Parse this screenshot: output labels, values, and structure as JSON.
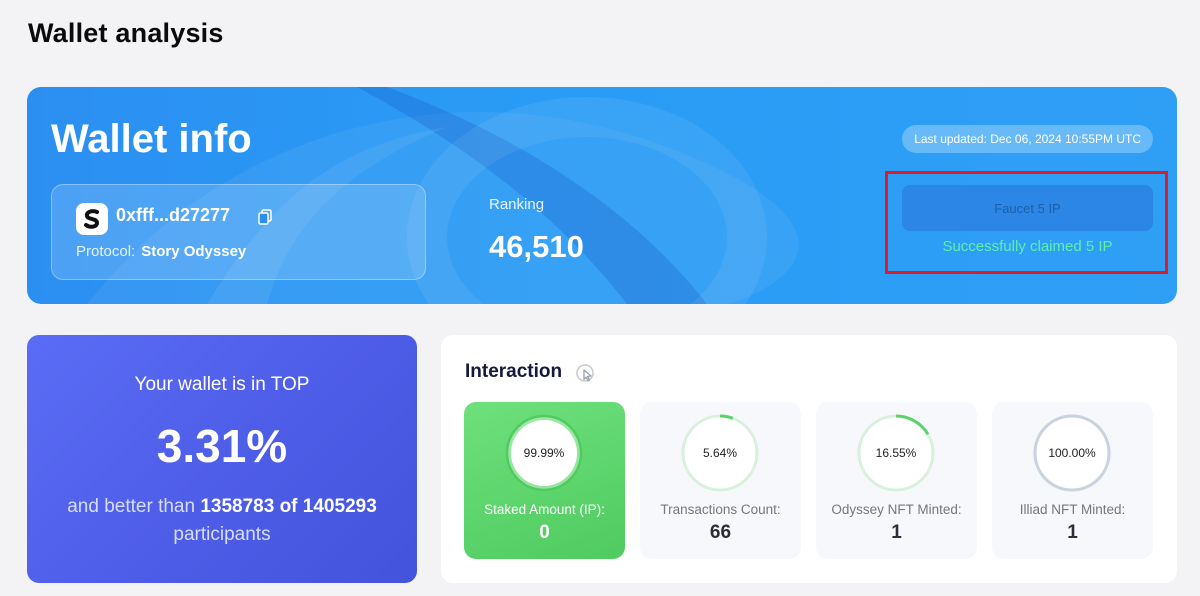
{
  "page": {
    "title": "Wallet analysis"
  },
  "wallet": {
    "title": "Wallet info",
    "last_updated": "Last updated: Dec 06, 2024 10:55PM UTC",
    "address": "0xfff...d27277",
    "protocol_label": "Protocol:",
    "protocol": "Story Odyssey",
    "ranking_label": "Ranking",
    "ranking": "46,510",
    "faucet_label": "Faucet 5 IP",
    "claim_status": "Successfully claimed 5 IP"
  },
  "top": {
    "label": "Your wallet is in TOP",
    "percent": "3.31%",
    "desc_prefix": "and better than",
    "better_count": "1358783",
    "of_word": "of",
    "total": "1405293",
    "desc_suffix": "participants"
  },
  "interaction": {
    "title": "Interaction",
    "stats": [
      {
        "percent": "99.99%",
        "fraction": 0.9999,
        "label": "Staked Amount (IP):",
        "value": "0"
      },
      {
        "percent": "5.64%",
        "fraction": 0.0564,
        "label": "Transactions Count:",
        "value": "66"
      },
      {
        "percent": "16.55%",
        "fraction": 0.1655,
        "label": "Odyssey NFT Minted:",
        "value": "1"
      },
      {
        "percent": "100.00%",
        "fraction": 1.0,
        "label": "Illiad NFT Minted:",
        "value": "1"
      }
    ]
  },
  "colors": {
    "ring_active": "#5ad46a",
    "ring_full": "#c9d2de",
    "highlight": "#e01b25",
    "success": "#5ff0a8"
  }
}
